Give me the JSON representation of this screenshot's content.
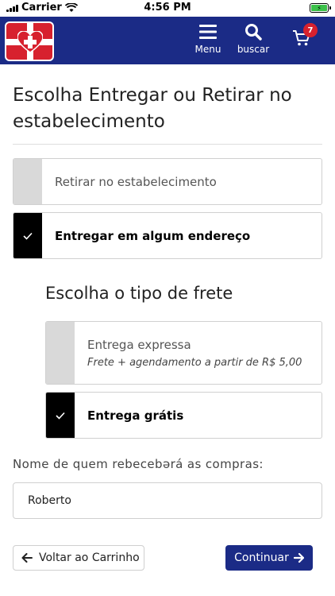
{
  "status_bar": {
    "carrier": "Carrier",
    "time": "4:56 PM"
  },
  "header": {
    "menu_label": "Menu",
    "search_label": "buscar",
    "cart_count": "7",
    "brand_color": "#1b2b86",
    "accent_color": "#d7212e"
  },
  "page": {
    "title": "Escolha Entregar ou Retirar no estabelecimento"
  },
  "delivery_options": [
    {
      "label": "Retirar no estabelecimento",
      "selected": false
    },
    {
      "label": "Entregar em algum endereço",
      "selected": true
    }
  ],
  "shipping": {
    "title": "Escolha o tipo de frete",
    "options": [
      {
        "label": "Entrega expressa",
        "note": "Frete + agendamento a partir de R$ 5,00",
        "selected": false
      },
      {
        "label": "Entrega grátis",
        "selected": true
      }
    ]
  },
  "recipient": {
    "label": "Nome de quem rebecebərá as compras:",
    "value": "Roberto"
  },
  "actions": {
    "back_label": "Voltar ao Carrinho",
    "continue_label": "Continuar"
  }
}
